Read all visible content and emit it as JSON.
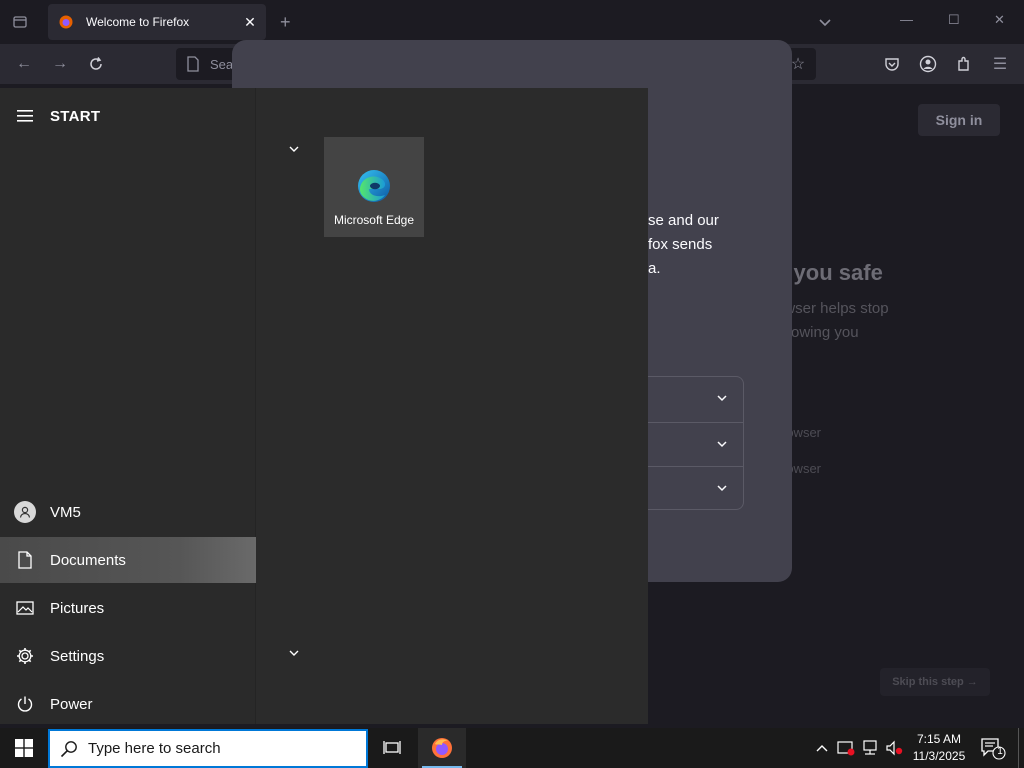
{
  "firefox": {
    "tab_title": "Welcome to Firefox",
    "url_placeholder": "Search or enter address",
    "signin_label": "Sign in",
    "bg_heading": "g you safe",
    "bg_line1": "owser helps stop",
    "bg_line2": "ollowing you",
    "bg_small1": "rowser",
    "bg_small2": "rowser",
    "skip_label": "Skip this step →"
  },
  "modal": {
    "line1": "se and our",
    "line2": "fox sends",
    "line3": "a."
  },
  "start_menu": {
    "title": "START",
    "user_name": "VM5",
    "items": [
      {
        "label": "Documents",
        "icon": "document-icon"
      },
      {
        "label": "Pictures",
        "icon": "pictures-icon"
      },
      {
        "label": "Settings",
        "icon": "gear-icon"
      },
      {
        "label": "Power",
        "icon": "power-icon"
      }
    ],
    "tiles": [
      {
        "label": "Microsoft Edge",
        "icon": "edge-icon"
      }
    ]
  },
  "taskbar": {
    "search_placeholder": "Type here to search",
    "time": "7:15 AM",
    "date": "11/3/2025",
    "notification_count": "1"
  },
  "colors": {
    "accent": "#0078d7",
    "firefox_bg": "#1c1b22",
    "modal_bg": "#42414d",
    "start_bg": "#2b2b2b",
    "taskbar_bg": "#1a1a1a"
  }
}
